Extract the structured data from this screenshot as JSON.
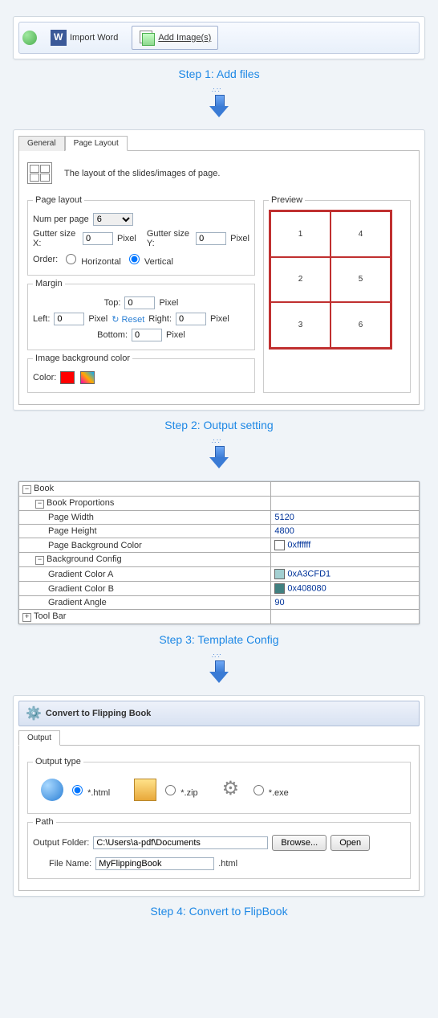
{
  "step1": {
    "label": "Step 1: Add files",
    "importWord": "Import Word",
    "addImages": "Add Image(s)"
  },
  "step2": {
    "label": "Step 2: Output setting",
    "tab_general": "General",
    "tab_pagelayout": "Page Layout",
    "desc": "The layout of the slides/images of page.",
    "pageLayout": {
      "legend": "Page layout",
      "numPerPageLabel": "Num per page",
      "numPerPage": "6",
      "gutterXLabel": "Gutter size X:",
      "gutterX": "0",
      "gutterYLabel": "Gutter size Y:",
      "gutterY": "0",
      "pixel": "Pixel",
      "orderLabel": "Order:",
      "horizontal": "Horizontal",
      "vertical": "Vertical"
    },
    "margin": {
      "legend": "Margin",
      "topLabel": "Top:",
      "top": "0",
      "leftLabel": "Left:",
      "left": "0",
      "rightLabel": "Right:",
      "right": "0",
      "bottomLabel": "Bottom:",
      "bottom": "0",
      "reset": "Reset",
      "pixel": "Pixel"
    },
    "bgColor": {
      "legend": "Image background color",
      "colorLabel": "Color:"
    },
    "preview": {
      "legend": "Preview",
      "cells": [
        "1",
        "4",
        "2",
        "5",
        "3",
        "6"
      ]
    }
  },
  "step3": {
    "label": "Step 3: Template Config",
    "rows": [
      {
        "indent": 0,
        "toggle": "-",
        "name": "Book",
        "value": ""
      },
      {
        "indent": 1,
        "toggle": "-",
        "name": "Book Proportions",
        "value": ""
      },
      {
        "indent": 2,
        "toggle": "",
        "name": "Page Width",
        "value": "5120"
      },
      {
        "indent": 2,
        "toggle": "",
        "name": "Page Height",
        "value": "4800"
      },
      {
        "indent": 2,
        "toggle": "",
        "name": "Page Background Color",
        "value": "0xffffff",
        "swatch": "#ffffff"
      },
      {
        "indent": 1,
        "toggle": "-",
        "name": "Background Config",
        "value": ""
      },
      {
        "indent": 2,
        "toggle": "",
        "name": "Gradient Color A",
        "value": "0xA3CFD1",
        "swatch": "#A3CFD1"
      },
      {
        "indent": 2,
        "toggle": "",
        "name": "Gradient Color B",
        "value": "0x408080",
        "swatch": "#408080"
      },
      {
        "indent": 2,
        "toggle": "",
        "name": "Gradient Angle",
        "value": "90"
      },
      {
        "indent": 0,
        "toggle": "+",
        "name": "Tool Bar",
        "value": ""
      }
    ]
  },
  "step4": {
    "label": "Step 4: Convert to FlipBook",
    "title": "Convert to Flipping Book",
    "tab_output": "Output",
    "outputType": {
      "legend": "Output type",
      "html": "*.html",
      "zip": "*.zip",
      "exe": "*.exe"
    },
    "path": {
      "legend": "Path",
      "outputFolderLabel": "Output Folder:",
      "outputFolder": "C:\\Users\\a-pdf\\Documents",
      "browse": "Browse...",
      "open": "Open",
      "fileNameLabel": "File Name:",
      "fileName": "MyFlippingBook",
      "ext": ".html"
    }
  }
}
